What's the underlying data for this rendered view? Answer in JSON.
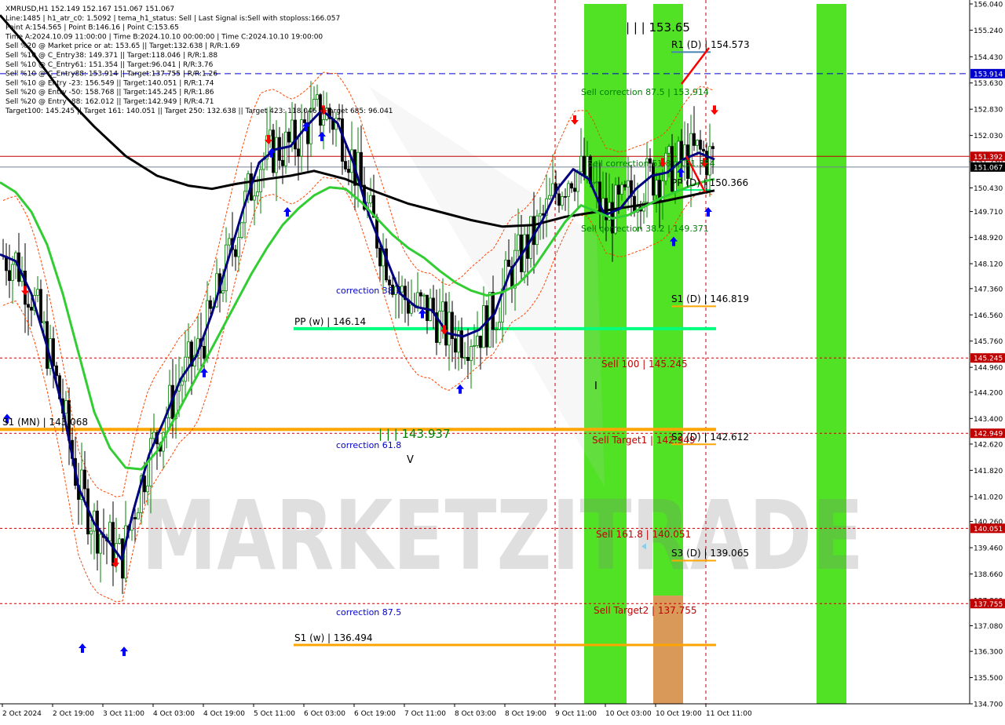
{
  "header": {
    "lines": [
      "XMRUSD,H1  152.149 152.167 151.067 151.067",
      "Line:1485 | h1_atr_c0: 1.5092 | tema_h1_status: Sell | Last Signal is:Sell with stoploss:166.057",
      "Point A:154.565 | Point B:146.16 | Point C:153.65",
      "Time A:2024.10.09 11:00:00 | Time B:2024.10.10 00:00:00 | Time C:2024.10.10 19:00:00",
      "Sell %20 @ Market price or at: 153.65 || Target:132.638 | R/R:1.69",
      "Sell %10 @ C_Entry38: 149.371 || Target:118.046 | R/R:1.88",
      "Sell %10 @ C_Entry61: 151.354 || Target:96.041 | R/R:3.76",
      "Sell %10 @ C_Entry88: 153.914 || Target:137.755 | R/R:1.26",
      "Sell %10 @ Entry -23: 156.549 || Target:140.051 | R/R:1.74",
      "Sell %20 @ Entry -50: 158.768 || Target:145.245 | R/R:1.86",
      "Sell %20 @ Entry -88: 162.012 || Target:142.949 | R/R:4.71",
      "Target100: 145.245 || Target 161: 140.051 || Target 250: 132.638 || Target 423: 118.046 || Target 685: 96.041"
    ]
  },
  "watermark": "MARKETZITRADE",
  "colors": {
    "up": "#008000",
    "down": "#000000",
    "ema_slow": "#000000",
    "ema_mid": "#000080",
    "ema_fast": "#32cd32",
    "band": "#ff4500",
    "green_zone": "#33dd00",
    "orange_zone": "#cc7722",
    "pivot_orange": "#ffa500",
    "pivot_green": "#00ff7f",
    "red_level": "#c00000",
    "blue_level": "#0000cd"
  },
  "chart_data": {
    "type": "candlestick",
    "symbol": "XMRUSD",
    "timeframe": "H1",
    "ylim": [
      134.7,
      156.04
    ],
    "y_ticks": [
      "156.040",
      "155.240",
      "154.430",
      "153.630",
      "152.830",
      "152.030",
      "151.230",
      "150.430",
      "149.710",
      "148.920",
      "148.120",
      "147.360",
      "146.560",
      "145.760",
      "144.960",
      "144.200",
      "143.400",
      "142.620",
      "141.820",
      "141.020",
      "140.260",
      "139.460",
      "138.660",
      "137.860",
      "137.080",
      "136.300",
      "135.500",
      "134.700"
    ],
    "x_labels": [
      "2 Oct 2024",
      "2 Oct 19:00",
      "3 Oct 11:00",
      "4 Oct 03:00",
      "4 Oct 19:00",
      "5 Oct 11:00",
      "6 Oct 03:00",
      "6 Oct 19:00",
      "7 Oct 11:00",
      "8 Oct 03:00",
      "8 Oct 19:00",
      "9 Oct 11:00",
      "10 Oct 03:00",
      "10 Oct 19:00",
      "11 Oct 11:00"
    ],
    "price_tags": [
      {
        "price": 153.914,
        "label": "153.914",
        "color": "#0000cd"
      },
      {
        "price": 151.392,
        "label": "151.392",
        "color": "#c00000"
      },
      {
        "price": 151.067,
        "label": "151.067",
        "color": "#000000"
      },
      {
        "price": 145.245,
        "label": "145.245",
        "color": "#c00000"
      },
      {
        "price": 142.949,
        "label": "142.949",
        "color": "#c00000"
      },
      {
        "price": 140.051,
        "label": "140.051",
        "color": "#c00000"
      },
      {
        "price": 137.755,
        "label": "137.755",
        "color": "#c00000"
      }
    ],
    "level_labels": [
      {
        "text": "R1 (D) | 154.573",
        "price": 154.573,
        "color": "#000000"
      },
      {
        "text": "PP (D) | 150.366",
        "price": 150.366,
        "color": "#000000"
      },
      {
        "text": "S1 (D) | 146.819",
        "price": 146.819,
        "color": "#000000"
      },
      {
        "text": "S2 (D) | 142.612",
        "price": 142.612,
        "color": "#000000"
      },
      {
        "text": "S3 (D) | 139.065",
        "price": 139.065,
        "color": "#000000"
      },
      {
        "text": "PP (w) | 146.14",
        "price": 146.14,
        "color": "#000000"
      },
      {
        "text": "S1 (w) | 136.494",
        "price": 136.494,
        "color": "#000000"
      },
      {
        "text": "S1 (MN) | 143.068",
        "price": 143.068,
        "color": "#000000"
      },
      {
        "text": "| | | 153.65",
        "price": 153.65,
        "color": "#000000"
      },
      {
        "text": "| | | 143.937",
        "price": 143.937,
        "color": "#008000"
      },
      {
        "text": "Sell 100 | 145.245",
        "price": 145.245,
        "color": "#c00000"
      },
      {
        "text": "Sell Target1 | 142.949",
        "price": 142.949,
        "color": "#c00000"
      },
      {
        "text": "Sell 161.8 | 140.051",
        "price": 140.051,
        "color": "#c00000"
      },
      {
        "text": "Sell Target2 | 137.755",
        "price": 137.755,
        "color": "#c00000"
      },
      {
        "text": "Sell correction 87.5 | 153.914",
        "price": 153.914,
        "color": "#008000"
      },
      {
        "text": "Sell correction 61.8 | 151.354",
        "price": 151.354,
        "color": "#008000"
      },
      {
        "text": "Sell correction 38.2 | 149.371",
        "price": 149.371,
        "color": "#008000"
      },
      {
        "text": "correction 38.2",
        "price": 147.3,
        "color": "#0000cd"
      },
      {
        "text": "correction 61.8",
        "price": 142.6,
        "color": "#0000cd"
      },
      {
        "text": "correction 87.5",
        "price": 137.7,
        "color": "#0000cd"
      }
    ],
    "zones": [
      {
        "color": "green",
        "from": "6 Oct 00:00",
        "to": "6 Oct 06:00",
        "low": 134.7,
        "high": 156.04
      },
      {
        "color": "green",
        "from": "6 Oct 11:00",
        "to": "6 Oct 15:00",
        "low": 138.0,
        "high": 156.04
      },
      {
        "color": "orange",
        "from": "6 Oct 11:00",
        "to": "6 Oct 15:00",
        "low": 134.7,
        "high": 138.0
      },
      {
        "color": "green",
        "from": "7 Oct 13:00",
        "to": "7 Oct 17:00",
        "low": 134.7,
        "high": 156.04
      },
      {
        "color": "green",
        "from": "9 Oct 13:00",
        "to": "9 Oct 19:00",
        "low": 145.3,
        "high": 155.9
      },
      {
        "color": "orange",
        "from": "9 Oct 13:00",
        "to": "9 Oct 19:00",
        "low": 155.9,
        "high": 156.04
      },
      {
        "color": "green",
        "from": "10 Oct 17:00",
        "to": "10 Oct 21:00",
        "low": 137.8,
        "high": 153.5
      },
      {
        "color": "orange",
        "from": "10 Oct 17:00",
        "to": "10 Oct 21:00",
        "low": 153.5,
        "high": 156.04
      },
      {
        "color": "green",
        "from": "11 Oct 02:00",
        "to": "11 Oct 06:00",
        "low": 142.9,
        "high": 156.04
      }
    ],
    "series": [
      {
        "name": "ema_slow",
        "points": [
          [
            0,
            155.7
          ],
          [
            40,
            154.6
          ],
          [
            80,
            153.3
          ],
          [
            120,
            152.3
          ],
          [
            160,
            151.4
          ],
          [
            200,
            150.8
          ],
          [
            240,
            150.5
          ],
          [
            270,
            150.4
          ],
          [
            300,
            150.55
          ],
          [
            340,
            150.7
          ],
          [
            370,
            150.8
          ],
          [
            400,
            150.95
          ],
          [
            440,
            150.7
          ],
          [
            480,
            150.3
          ],
          [
            520,
            149.95
          ],
          [
            560,
            149.7
          ],
          [
            600,
            149.45
          ],
          [
            640,
            149.25
          ],
          [
            680,
            149.3
          ],
          [
            720,
            149.55
          ],
          [
            760,
            149.7
          ],
          [
            800,
            149.85
          ],
          [
            840,
            150.0
          ],
          [
            880,
            150.2
          ],
          [
            910,
            150.35
          ]
        ]
      },
      {
        "name": "ema_mid",
        "points": [
          [
            0,
            148.4
          ],
          [
            20,
            148.2
          ],
          [
            40,
            147.2
          ],
          [
            60,
            145.6
          ],
          [
            80,
            143.7
          ],
          [
            100,
            141.3
          ],
          [
            120,
            140.2
          ],
          [
            140,
            139.6
          ],
          [
            155,
            139.1
          ],
          [
            170,
            140.6
          ],
          [
            190,
            142.3
          ],
          [
            210,
            143.4
          ],
          [
            230,
            144.6
          ],
          [
            250,
            145.3
          ],
          [
            270,
            146.6
          ],
          [
            290,
            148.2
          ],
          [
            310,
            149.8
          ],
          [
            330,
            151.2
          ],
          [
            350,
            151.6
          ],
          [
            370,
            151.7
          ],
          [
            390,
            152.3
          ],
          [
            410,
            152.8
          ],
          [
            430,
            152.4
          ],
          [
            450,
            151.2
          ],
          [
            470,
            149.6
          ],
          [
            490,
            148.4
          ],
          [
            510,
            147.2
          ],
          [
            530,
            146.8
          ],
          [
            550,
            146.7
          ],
          [
            570,
            146.0
          ],
          [
            590,
            145.9
          ],
          [
            610,
            146.1
          ],
          [
            630,
            146.6
          ],
          [
            650,
            147.9
          ],
          [
            670,
            148.6
          ],
          [
            690,
            149.4
          ],
          [
            710,
            150.4
          ],
          [
            730,
            151.0
          ],
          [
            750,
            150.7
          ],
          [
            770,
            149.6
          ],
          [
            790,
            149.8
          ],
          [
            810,
            150.4
          ],
          [
            830,
            150.8
          ],
          [
            850,
            150.9
          ],
          [
            870,
            151.3
          ],
          [
            890,
            151.5
          ],
          [
            910,
            151.3
          ]
        ]
      },
      {
        "name": "ema_fast",
        "points": [
          [
            0,
            150.6
          ],
          [
            20,
            150.3
          ],
          [
            40,
            149.7
          ],
          [
            60,
            148.7
          ],
          [
            80,
            147.2
          ],
          [
            100,
            145.4
          ],
          [
            120,
            143.6
          ],
          [
            140,
            142.5
          ],
          [
            160,
            141.9
          ],
          [
            180,
            141.85
          ],
          [
            200,
            142.4
          ],
          [
            220,
            143.3
          ],
          [
            240,
            144.2
          ],
          [
            260,
            145.1
          ],
          [
            280,
            146.0
          ],
          [
            300,
            146.9
          ],
          [
            320,
            147.8
          ],
          [
            340,
            148.6
          ],
          [
            360,
            149.3
          ],
          [
            380,
            149.8
          ],
          [
            400,
            150.2
          ],
          [
            420,
            150.45
          ],
          [
            440,
            150.4
          ],
          [
            460,
            150.0
          ],
          [
            480,
            149.5
          ],
          [
            500,
            149.0
          ],
          [
            520,
            148.6
          ],
          [
            540,
            148.3
          ],
          [
            560,
            147.9
          ],
          [
            580,
            147.55
          ],
          [
            600,
            147.3
          ],
          [
            620,
            147.15
          ],
          [
            640,
            147.25
          ],
          [
            660,
            147.5
          ],
          [
            680,
            148.0
          ],
          [
            700,
            148.7
          ],
          [
            720,
            149.4
          ],
          [
            740,
            149.9
          ],
          [
            760,
            149.7
          ],
          [
            780,
            149.5
          ],
          [
            800,
            149.6
          ],
          [
            820,
            149.85
          ],
          [
            840,
            150.1
          ],
          [
            860,
            150.3
          ],
          [
            880,
            150.5
          ],
          [
            900,
            150.65
          ],
          [
            910,
            150.7
          ]
        ]
      }
    ]
  }
}
